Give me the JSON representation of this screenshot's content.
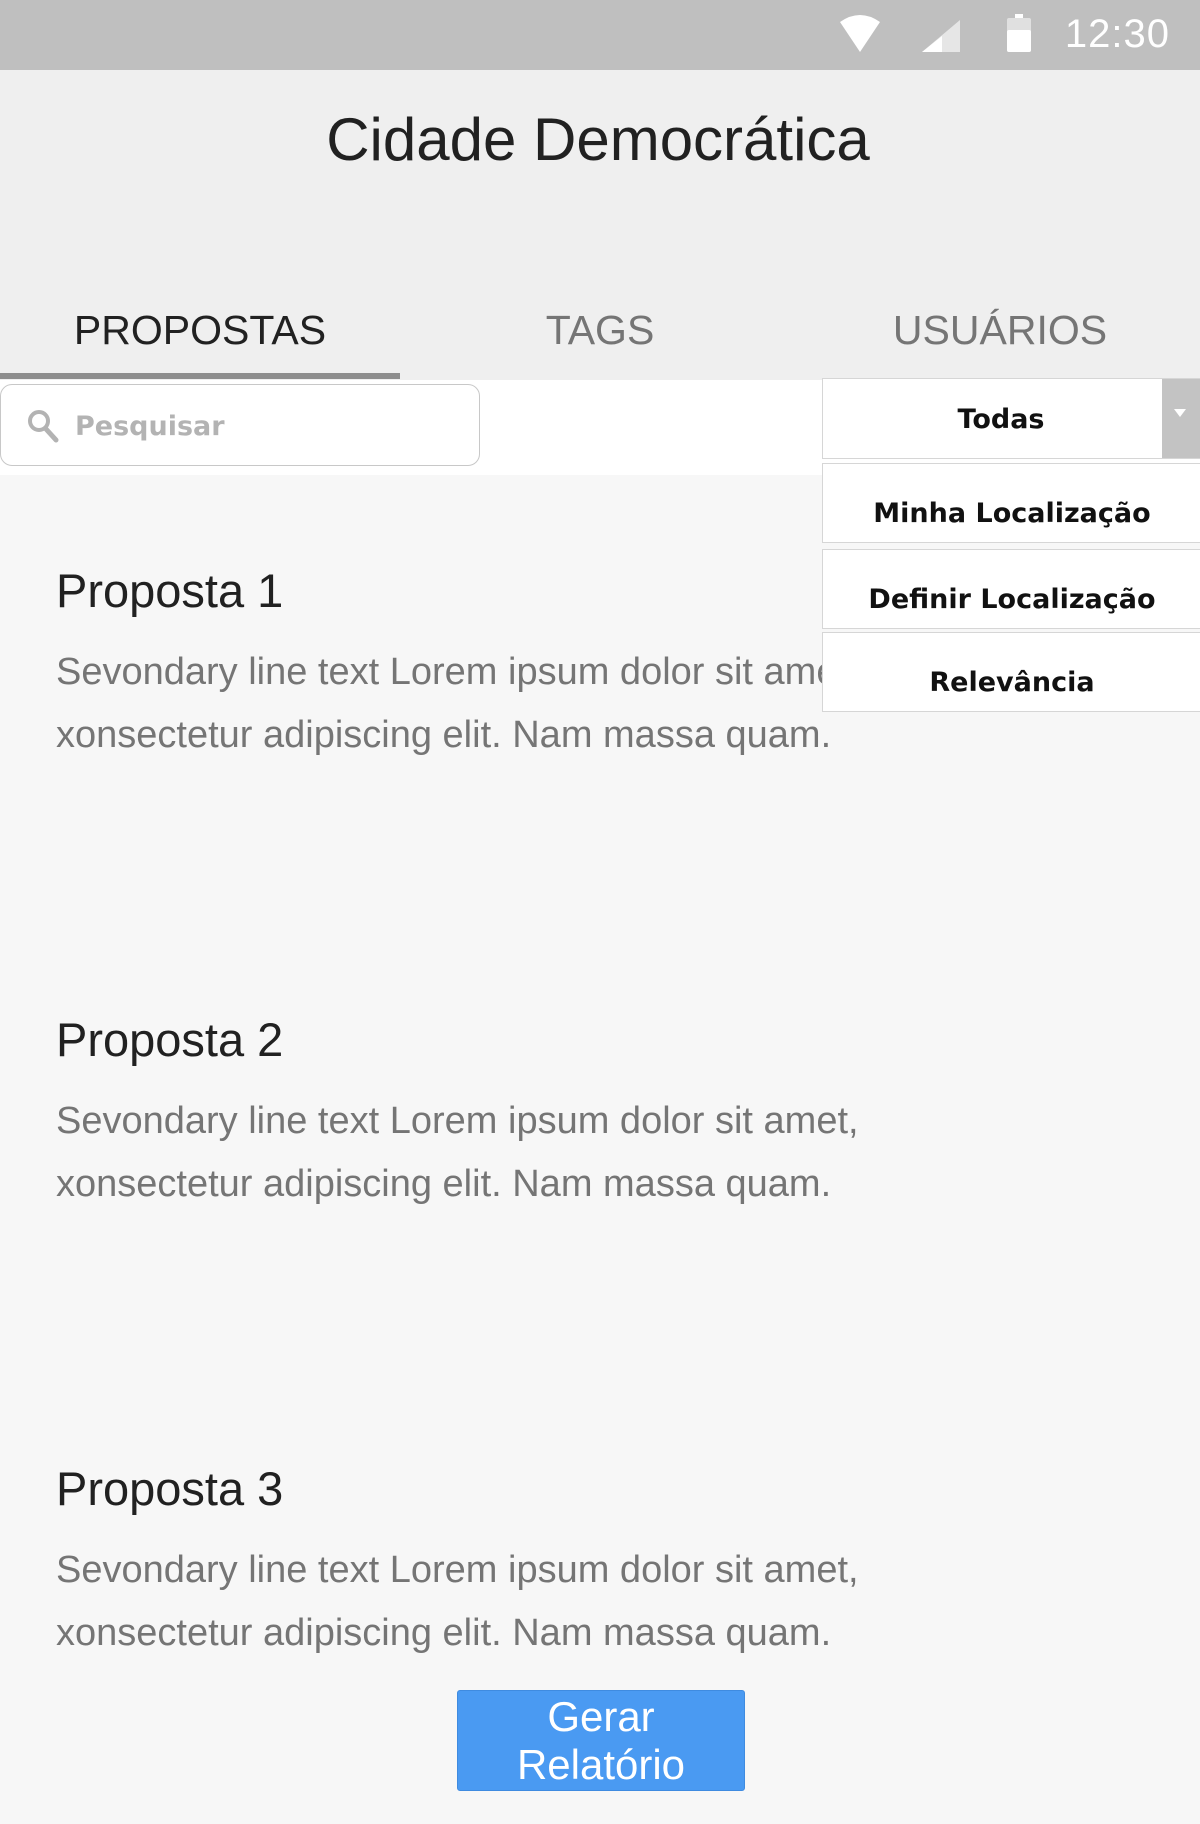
{
  "status_bar": {
    "time": "12:30",
    "icons": [
      "wifi-icon",
      "signal-icon",
      "battery-icon"
    ]
  },
  "header": {
    "title": "Cidade Democrática"
  },
  "tabs": [
    {
      "label": "PROPOSTAS",
      "active": true
    },
    {
      "label": "TAGS",
      "active": false
    },
    {
      "label": "USUÁRIOS",
      "active": false
    }
  ],
  "search": {
    "placeholder": "Pesquisar"
  },
  "filter": {
    "selected": "Todas",
    "options": [
      "Minha Localização",
      "Definir Localização",
      "Relevância"
    ]
  },
  "proposals": [
    {
      "title": "Proposta 1",
      "text": "Sevondary line text Lorem ipsum dolor sit amet, xonsectetur adipiscing elit. Nam massa quam."
    },
    {
      "title": "Proposta 2",
      "text": "Sevondary line text Lorem ipsum dolor sit amet, xonsectetur adipiscing elit. Nam massa quam."
    },
    {
      "title": "Proposta 3",
      "text": "Sevondary line text Lorem ipsum dolor sit amet, xonsectetur adipiscing elit. Nam massa quam."
    }
  ],
  "actions": {
    "report_label": "Gerar Relatório"
  },
  "colors": {
    "accent": "#4a9af2",
    "status_bar": "#bfbfbf",
    "header": "#efefef",
    "tab_indicator": "#8e8e8e"
  }
}
